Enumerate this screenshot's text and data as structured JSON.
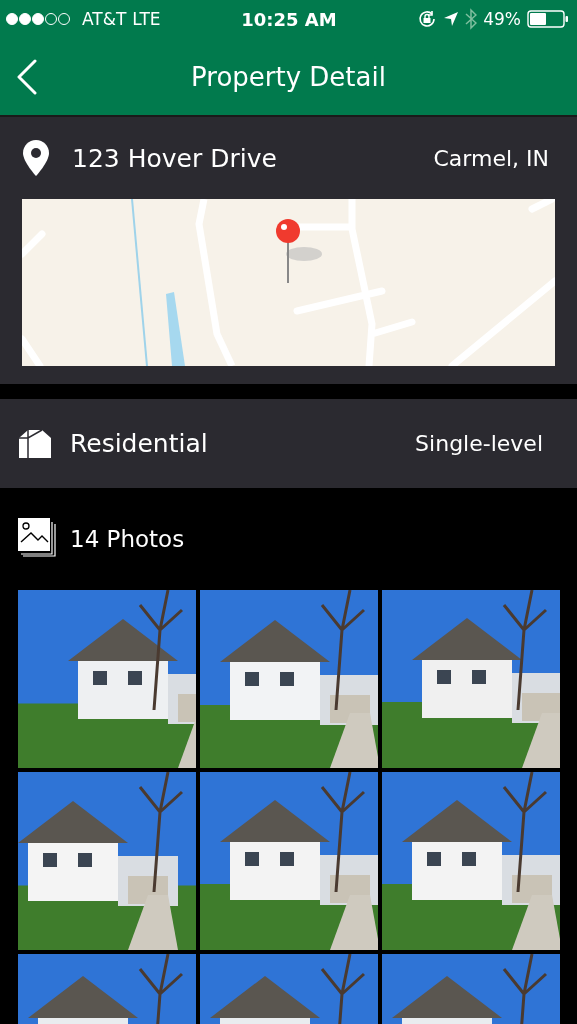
{
  "status_bar": {
    "carrier": "AT&T",
    "network": "LTE",
    "time": "10:25 AM",
    "battery": "49%"
  },
  "nav": {
    "title": "Property Detail"
  },
  "address": {
    "street": "123 Hover Drive",
    "city": "Carmel, IN"
  },
  "property": {
    "type": "Residential",
    "style": "Single-level"
  },
  "photos": {
    "count": "14 Photos"
  }
}
